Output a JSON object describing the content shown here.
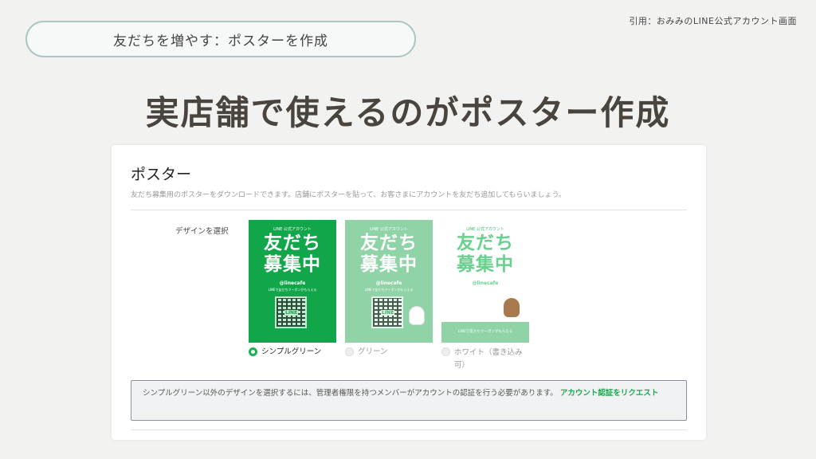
{
  "source_note": "引用：おみみのLINE公式アカウント画面",
  "topic_pill": "友だちを増やす：ポスターを作成",
  "headline": "実店舗で使えるのがポスター作成",
  "panel": {
    "title": "ポスター",
    "description": "友だち募集用のポスターをダウンロードできます。店舗にポスターを貼って、お客さまにアカウントを友だち追加してもらいましょう。",
    "field_label": "デザインを選択",
    "posters": {
      "small_label": "LINE 公式アカウント",
      "big_line1": "友だち",
      "big_line2": "募集中",
      "account_id": "@linecafe",
      "sub_text": "LINEで友だちクーポンがもらえる",
      "qr_label": "LINE",
      "band_text": "LINEで友だちクーポンがもらえる"
    },
    "options": [
      {
        "label": "シンプルグリーン",
        "selected": true
      },
      {
        "label": "グリーン",
        "selected": false
      },
      {
        "label": "ホワイト（書き込み可）",
        "selected": false
      }
    ],
    "notice": {
      "text": "シンプルグリーン以外のデザインを選択するには、管理者権限を持つメンバーがアカウントの認証を行う必要があります。",
      "link": "アカウント認証をリクエスト"
    }
  },
  "colors": {
    "line_green": "#12a64a",
    "light_green": "#8fd3a7",
    "link_green": "#1aaa4d",
    "headline": "#4a443f"
  }
}
